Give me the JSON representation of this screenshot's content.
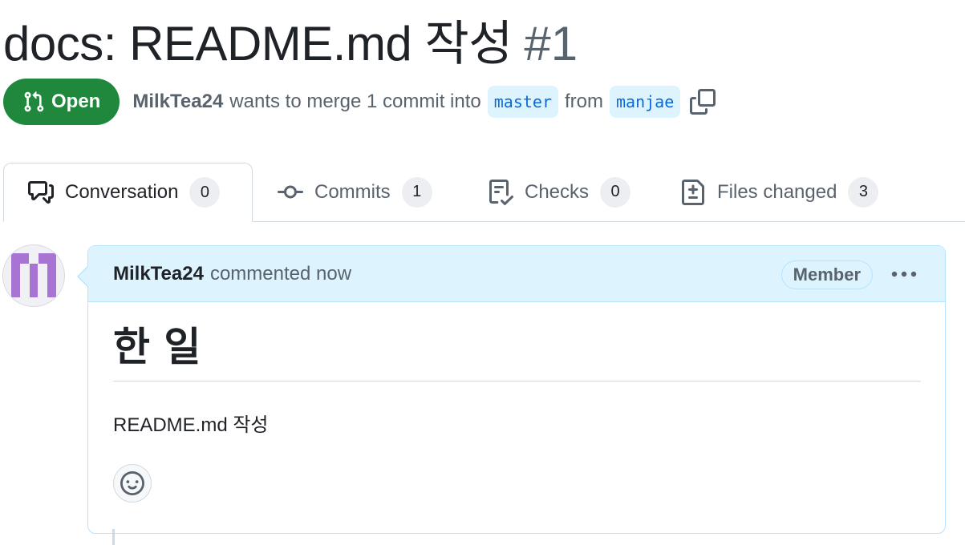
{
  "pr": {
    "title": "docs: README.md 작성",
    "number": "#1",
    "state": "Open",
    "author": "MilkTea24",
    "merge_text_before": "wants to merge 1 commit into",
    "base_branch": "master",
    "from_text": "from",
    "head_branch": "manjae"
  },
  "tabs": [
    {
      "label": "Conversation",
      "count": "0",
      "icon": "comment-discussion-icon",
      "active": true
    },
    {
      "label": "Commits",
      "count": "1",
      "icon": "git-commit-icon"
    },
    {
      "label": "Checks",
      "count": "0",
      "icon": "checklist-icon"
    },
    {
      "label": "Files changed",
      "count": "3",
      "icon": "file-diff-icon"
    }
  ],
  "comment": {
    "author": "MilkTea24",
    "time": "commented now",
    "role": "Member",
    "heading": "한 일",
    "text": "README.md 작성"
  },
  "colors": {
    "open_green": "#1f883d",
    "branch_blue": "#0969da",
    "header_bg": "#ddf4ff",
    "avatar_purple": "#a774d3"
  }
}
